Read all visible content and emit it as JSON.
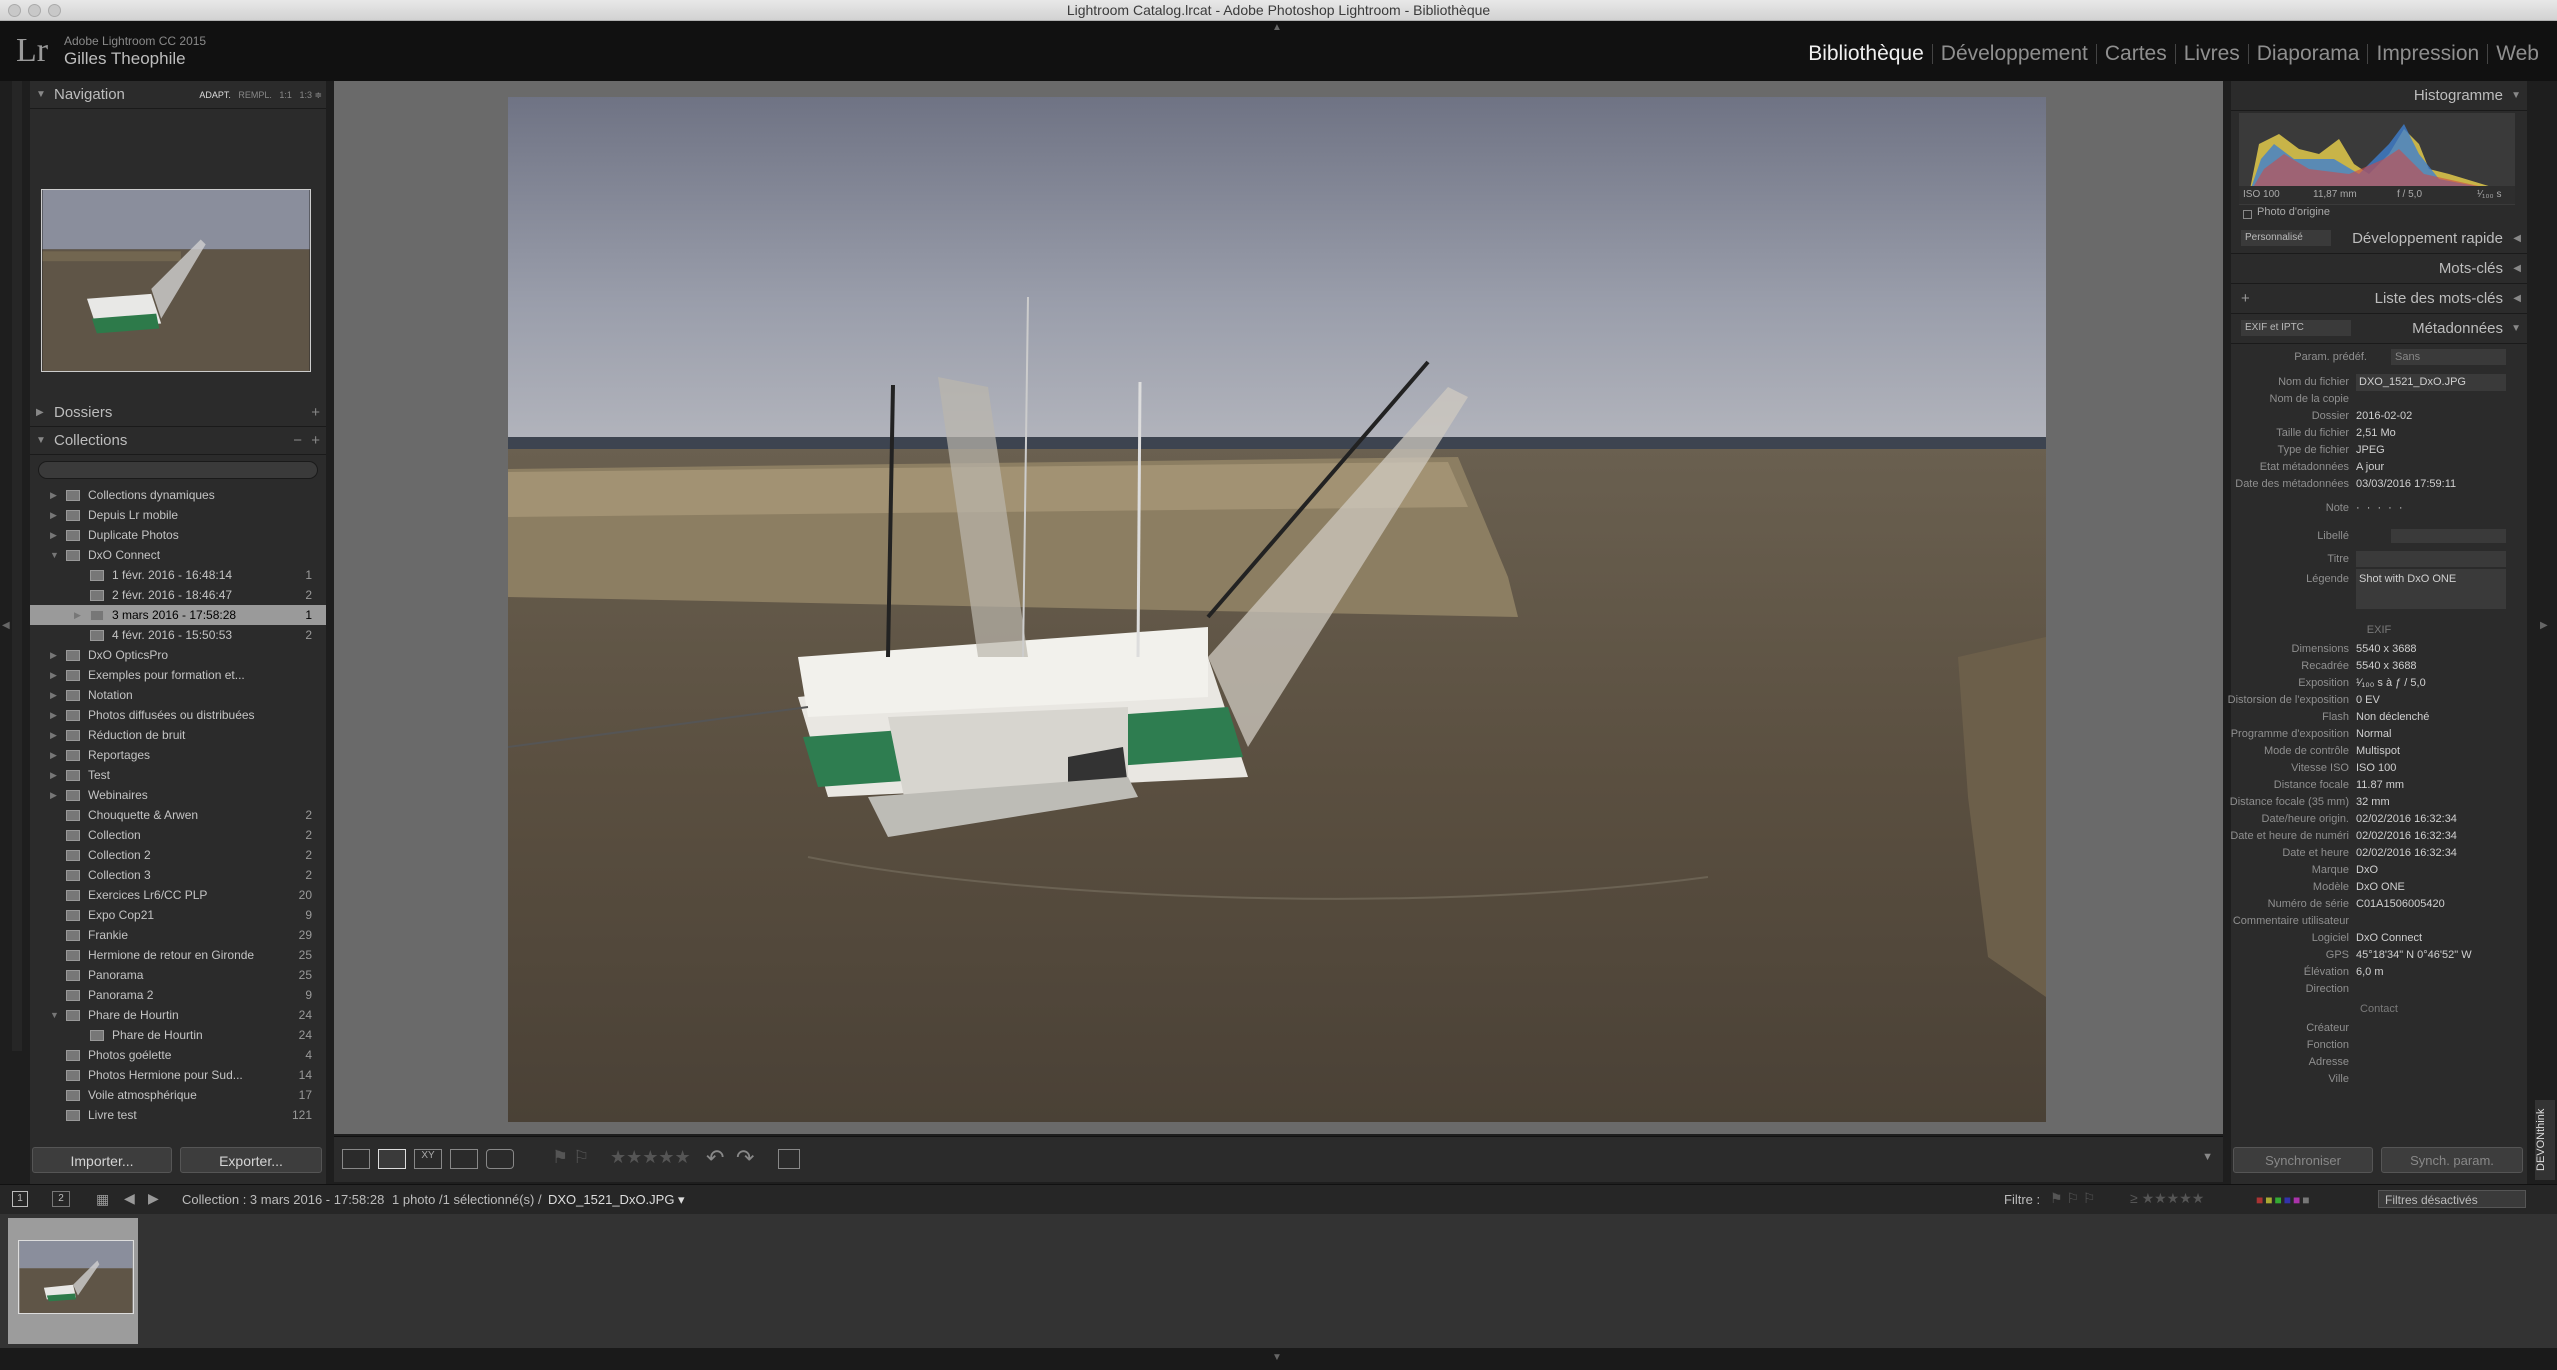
{
  "window": {
    "title": "Lightroom Catalog.lrcat - Adobe Photoshop Lightroom - Bibliothèque"
  },
  "identity": {
    "logo": "Lr",
    "product": "Adobe Lightroom CC 2015",
    "user": "Gilles Theophile"
  },
  "modules": [
    "Bibliothèque",
    "Développement",
    "Cartes",
    "Livres",
    "Diaporama",
    "Impression",
    "Web"
  ],
  "active_module": "Bibliothèque",
  "left": {
    "navigation": {
      "title": "Navigation",
      "opts": [
        "ADAPT.",
        "REMPL.",
        "1:1",
        "1:3"
      ]
    },
    "dossiers": {
      "title": "Dossiers"
    },
    "collections": {
      "title": "Collections",
      "items": [
        {
          "label": "Collections dynamiques",
          "level": 1,
          "count": "",
          "expander": "▶"
        },
        {
          "label": "Depuis Lr mobile",
          "level": 1,
          "count": "",
          "expander": "▶"
        },
        {
          "label": "Duplicate Photos",
          "level": 1,
          "count": "",
          "expander": "▶"
        },
        {
          "label": "DxO Connect",
          "level": 1,
          "count": "",
          "expander": "▼"
        },
        {
          "label": "1 févr. 2016 - 16:48:14",
          "level": 2,
          "count": "1",
          "expander": ""
        },
        {
          "label": "2 févr. 2016 - 18:46:47",
          "level": 2,
          "count": "2",
          "expander": ""
        },
        {
          "label": "3 mars 2016 - 17:58:28",
          "level": 2,
          "count": "1",
          "expander": "▶",
          "selected": true
        },
        {
          "label": "4 févr. 2016 - 15:50:53",
          "level": 2,
          "count": "2",
          "expander": ""
        },
        {
          "label": "DxO OpticsPro",
          "level": 1,
          "count": "",
          "expander": "▶"
        },
        {
          "label": "Exemples pour formation et...",
          "level": 1,
          "count": "",
          "expander": "▶"
        },
        {
          "label": "Notation",
          "level": 1,
          "count": "",
          "expander": "▶"
        },
        {
          "label": "Photos diffusées ou distribuées",
          "level": 1,
          "count": "",
          "expander": "▶"
        },
        {
          "label": "Réduction de bruit",
          "level": 1,
          "count": "",
          "expander": "▶"
        },
        {
          "label": "Reportages",
          "level": 1,
          "count": "",
          "expander": "▶"
        },
        {
          "label": "Test",
          "level": 1,
          "count": "",
          "expander": "▶"
        },
        {
          "label": "Webinaires",
          "level": 1,
          "count": "",
          "expander": "▶"
        },
        {
          "label": "Chouquette & Arwen",
          "level": 1,
          "count": "2",
          "expander": ""
        },
        {
          "label": "Collection",
          "level": 1,
          "count": "2",
          "expander": ""
        },
        {
          "label": "Collection 2",
          "level": 1,
          "count": "2",
          "expander": ""
        },
        {
          "label": "Collection 3",
          "level": 1,
          "count": "2",
          "expander": ""
        },
        {
          "label": "Exercices Lr6/CC PLP",
          "level": 1,
          "count": "20",
          "expander": ""
        },
        {
          "label": "Expo Cop21",
          "level": 1,
          "count": "9",
          "expander": ""
        },
        {
          "label": "Frankie",
          "level": 1,
          "count": "29",
          "expander": ""
        },
        {
          "label": "Hermione de retour en Gironde",
          "level": 1,
          "count": "25",
          "expander": ""
        },
        {
          "label": "Panorama",
          "level": 1,
          "count": "25",
          "expander": ""
        },
        {
          "label": "Panorama 2",
          "level": 1,
          "count": "9",
          "expander": ""
        },
        {
          "label": "Phare de Hourtin",
          "level": 1,
          "count": "24",
          "expander": "▼"
        },
        {
          "label": "Phare de Hourtin",
          "level": 2,
          "count": "24",
          "expander": ""
        },
        {
          "label": "Photos goélette",
          "level": 1,
          "count": "4",
          "expander": ""
        },
        {
          "label": "Photos Hermione pour Sud...",
          "level": 1,
          "count": "14",
          "expander": ""
        },
        {
          "label": "Voile atmosphérique",
          "level": 1,
          "count": "17",
          "expander": ""
        },
        {
          "label": "Livre test",
          "level": 1,
          "count": "121",
          "expander": ""
        }
      ]
    },
    "import_label": "Importer...",
    "export_label": "Exporter..."
  },
  "right": {
    "histogram": {
      "title": "Histogramme",
      "iso": "ISO 100",
      "focal": "11,87 mm",
      "aperture": "f / 5,0",
      "shutter": "¹⁄₁₀₀ s",
      "original": "Photo d'origine"
    },
    "quick_develop": {
      "title": "Développement rapide",
      "preset": "Personnalisé"
    },
    "keywords": {
      "title": "Mots-clés"
    },
    "keyword_list": {
      "title": "Liste des mots-clés"
    },
    "metadata": {
      "title": "Métadonnées",
      "preset_select": "EXIF et IPTC",
      "param_label": "Param. prédéf.",
      "param_value": "Sans",
      "rows": [
        {
          "k": "Nom du fichier",
          "v": "DXO_1521_DxO.JPG",
          "box": true
        },
        {
          "k": "Nom de la copie",
          "v": ""
        },
        {
          "k": "Dossier",
          "v": "2016-02-02"
        },
        {
          "k": "Taille du fichier",
          "v": "2,51 Mo"
        },
        {
          "k": "Type de fichier",
          "v": "JPEG"
        },
        {
          "k": "Etat métadonnées",
          "v": "A jour"
        },
        {
          "k": "Date des métadonnées",
          "v": "03/03/2016 17:59:11"
        }
      ],
      "note_label": "Note",
      "rating_dots": "· · · · ·",
      "label_label": "Libellé",
      "title_label": "Titre",
      "caption_label": "Légende",
      "caption_value": "Shot with DxO ONE",
      "exif_title": "EXIF",
      "exif_rows": [
        {
          "k": "Dimensions",
          "v": "5540 x 3688"
        },
        {
          "k": "Recadrée",
          "v": "5540 x 3688"
        },
        {
          "k": "Exposition",
          "v": "¹⁄₁₀₀ s à ƒ / 5,0"
        },
        {
          "k": "Distorsion de l'exposition",
          "v": "0 EV"
        },
        {
          "k": "Flash",
          "v": "Non déclenché"
        },
        {
          "k": "Programme d'exposition",
          "v": "Normal"
        },
        {
          "k": "Mode de contrôle",
          "v": "Multispot"
        },
        {
          "k": "Vitesse ISO",
          "v": "ISO 100"
        },
        {
          "k": "Distance focale",
          "v": "11.87 mm"
        },
        {
          "k": "Distance focale (35 mm)",
          "v": "32 mm"
        },
        {
          "k": "Date/heure origin.",
          "v": "02/02/2016 16:32:34"
        },
        {
          "k": "Date et heure de numéri",
          "v": "02/02/2016 16:32:34"
        },
        {
          "k": "Date et heure",
          "v": "02/02/2016 16:32:34"
        },
        {
          "k": "Marque",
          "v": "DxO"
        },
        {
          "k": "Modèle",
          "v": "DxO ONE"
        },
        {
          "k": "Numéro de série",
          "v": "C01A1506005420"
        },
        {
          "k": "Commentaire utilisateur",
          "v": ""
        },
        {
          "k": "Logiciel",
          "v": "DxO Connect"
        },
        {
          "k": "GPS",
          "v": "45°18'34\" N 0°46'52\" W"
        },
        {
          "k": "Élévation",
          "v": "6,0 m"
        },
        {
          "k": "Direction",
          "v": ""
        }
      ],
      "contact_title": "Contact",
      "contact_rows": [
        {
          "k": "Créateur",
          "v": ""
        },
        {
          "k": "Fonction",
          "v": ""
        },
        {
          "k": "Adresse",
          "v": ""
        },
        {
          "k": "Ville",
          "v": ""
        }
      ]
    },
    "sync_label": "Synchroniser",
    "sync_params_label": "Synch. param."
  },
  "toolbar": {
    "stars": "★★★★★"
  },
  "filmbar": {
    "screen1": "1",
    "screen2": "2",
    "source": "Collection : 3 mars 2016 - 17:58:28",
    "count": "1 photo /1 sélectionné(s) /",
    "filename": "DXO_1521_DxO.JPG ▾",
    "filter_label": "Filtre :",
    "filter_value": "Filtres désactivés"
  },
  "devonthink": "DEVONthink"
}
